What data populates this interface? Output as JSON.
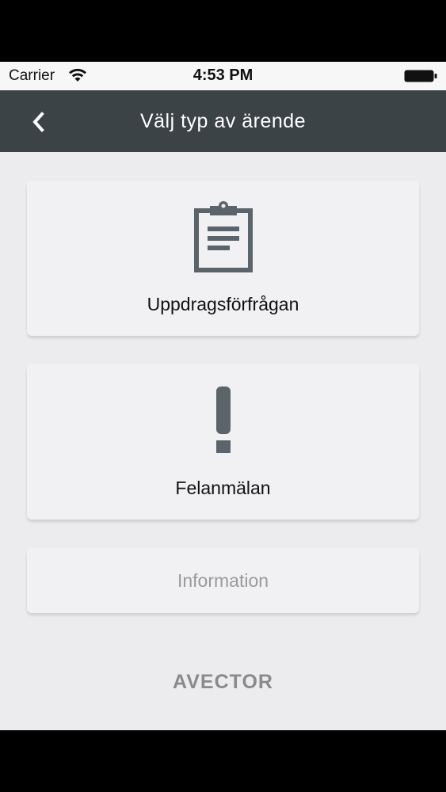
{
  "status_bar": {
    "carrier": "Carrier",
    "time": "4:53 PM"
  },
  "nav_bar": {
    "title": "Välj typ av ärende",
    "back_icon": "chevron-left-icon"
  },
  "cards": [
    {
      "label": "Uppdragsförfrågan",
      "icon": "clipboard-icon"
    },
    {
      "label": "Felanmälan",
      "icon": "exclamation-icon"
    },
    {
      "label": "Information"
    }
  ],
  "brand": {
    "logo_text": "AVECTOR"
  },
  "colors": {
    "nav_background": "#3b4347",
    "content_background": "#ececee",
    "card_background": "#f1f0f2",
    "icon_color": "#5b646a",
    "disabled_text": "#9a9a9c"
  }
}
